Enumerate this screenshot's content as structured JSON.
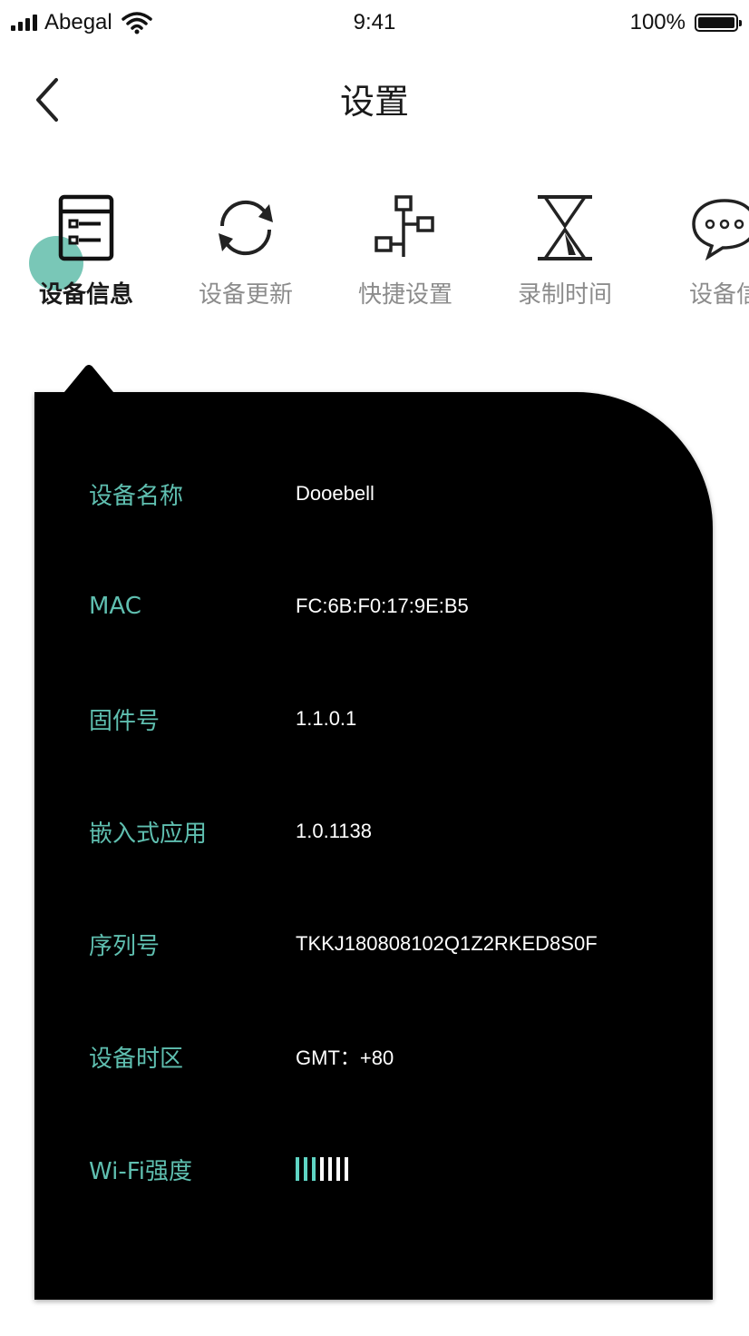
{
  "status_bar": {
    "carrier": "Abegal",
    "time": "9:41",
    "battery": "100%",
    "icons": [
      "signal-icon",
      "wifi-icon",
      "battery-icon"
    ]
  },
  "header": {
    "back_icon": "chevron-left-icon",
    "title": "设置"
  },
  "tabs": [
    {
      "label": "设备信息",
      "icon": "document-list-icon",
      "active": true
    },
    {
      "label": "设备更新",
      "icon": "refresh-icon",
      "active": false
    },
    {
      "label": "快捷设置",
      "icon": "network-icon",
      "active": false
    },
    {
      "label": "录制时间",
      "icon": "hourglass-icon",
      "active": false
    },
    {
      "label": "设备信",
      "icon": "chat-bubble-icon",
      "active": false
    }
  ],
  "device_info": {
    "rows": [
      {
        "label": "设备名称",
        "value": "Dooebell"
      },
      {
        "label": "MAC",
        "value": "FC:6B:F0:17:9E:B5"
      },
      {
        "label": "固件号",
        "value": "1.1.0.1"
      },
      {
        "label": "嵌入式应用",
        "value": "1.0.1138"
      },
      {
        "label": "序列号",
        "value": "TKKJ180808102Q1Z2RKED8S0F"
      },
      {
        "label": "设备时区",
        "value": "GMT：+80"
      }
    ],
    "wifi": {
      "label": "Wi-Fi强度",
      "level": 3,
      "max": 7
    }
  },
  "colors": {
    "accent": "#5fbfb0",
    "wifi_on": "#5fd4c4",
    "card_bg": "#000000",
    "indicator": "#61bdaa"
  }
}
